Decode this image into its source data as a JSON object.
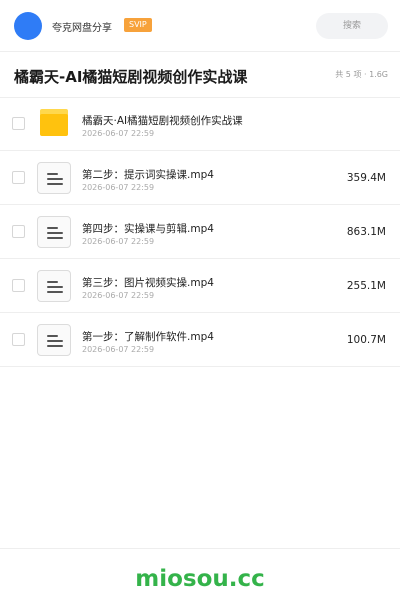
{
  "header": {
    "owner": "夸克网盘分享",
    "badge": "SVIP",
    "search_placeholder": "搜索"
  },
  "share": {
    "title": "橘霸天-AI橘猫短剧视频创作实战课",
    "summary": "共 5 项 · 1.6G"
  },
  "items": [
    {
      "type": "folder",
      "icon": "folder-icon",
      "name": "橘霸天·AI橘猫短剧视频创作实战课",
      "date": "2026-06-07 22:59",
      "size": ""
    },
    {
      "type": "file",
      "icon": "file-icon",
      "name": "第二步：提示词实操课.mp4",
      "date": "2026-06-07 22:59",
      "size": "359.4M"
    },
    {
      "type": "file",
      "icon": "file-icon",
      "name": "第四步：实操课与剪辑.mp4",
      "date": "2026-06-07 22:59",
      "size": "863.1M"
    },
    {
      "type": "file",
      "icon": "file-icon",
      "name": "第三步：图片视频实操.mp4",
      "date": "2026-06-07 22:59",
      "size": "255.1M"
    },
    {
      "type": "file",
      "icon": "file-icon",
      "name": "第一步：了解制作软件.mp4",
      "date": "2026-06-07 22:59",
      "size": "100.7M"
    }
  ],
  "footer": {
    "watermark": "miosou.cc"
  },
  "colors": {
    "avatar": "#2f7cf6",
    "badge": "#f7a23b",
    "folder": "#ffc20e",
    "watermark": "#34b34a"
  }
}
